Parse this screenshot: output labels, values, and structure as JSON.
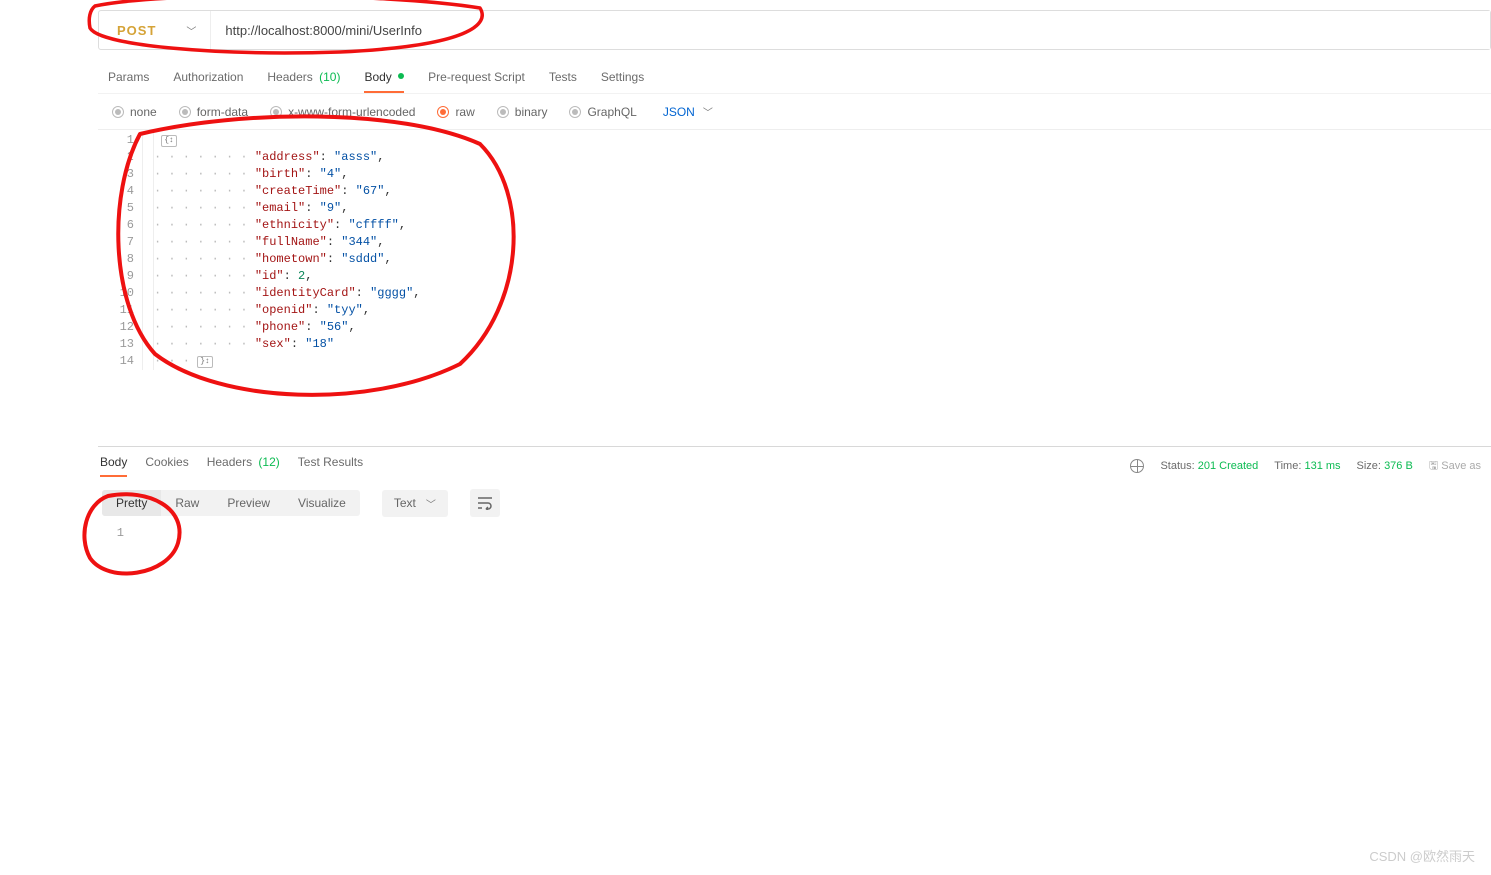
{
  "request": {
    "method": "POST",
    "url": "http://localhost:8000/mini/UserInfo",
    "tabs": {
      "params": "Params",
      "authorization": "Authorization",
      "headers": "Headers",
      "headers_count": "(10)",
      "body": "Body",
      "prerequest": "Pre-request Script",
      "tests": "Tests",
      "settings": "Settings"
    },
    "body_types": {
      "none": "none",
      "form_data": "form-data",
      "urlencoded": "x-www-form-urlencoded",
      "raw": "raw",
      "binary": "binary",
      "graphql": "GraphQL"
    },
    "lang": "JSON",
    "code": {
      "lines": [
        "1",
        "2",
        "3",
        "4",
        "5",
        "6",
        "7",
        "8",
        "9",
        "10",
        "11",
        "12",
        "13",
        "14"
      ],
      "pairs": [
        {
          "k": "\"address\"",
          "v": "\"asss\"",
          "t": "str",
          "comma": true
        },
        {
          "k": "\"birth\"",
          "v": "\"4\"",
          "t": "str",
          "comma": true
        },
        {
          "k": "\"createTime\"",
          "v": "\"67\"",
          "t": "str",
          "comma": true
        },
        {
          "k": "\"email\"",
          "v": "\"9\"",
          "t": "str",
          "comma": true
        },
        {
          "k": "\"ethnicity\"",
          "v": "\"cffff\"",
          "t": "str",
          "comma": true
        },
        {
          "k": "\"fullName\"",
          "v": "\"344\"",
          "t": "str",
          "comma": true
        },
        {
          "k": "\"hometown\"",
          "v": "\"sddd\"",
          "t": "str",
          "comma": true
        },
        {
          "k": "\"id\"",
          "v": "2",
          "t": "num",
          "comma": true
        },
        {
          "k": "\"identityCard\"",
          "v": "\"gggg\"",
          "t": "str",
          "comma": true
        },
        {
          "k": "\"openid\"",
          "v": "\"tyy\"",
          "t": "str",
          "comma": true
        },
        {
          "k": "\"phone\"",
          "v": "\"56\"",
          "t": "str",
          "comma": true
        },
        {
          "k": "\"sex\"",
          "v": "\"18\"",
          "t": "str",
          "comma": false
        }
      ]
    }
  },
  "response": {
    "tabs": {
      "body": "Body",
      "cookies": "Cookies",
      "headers": "Headers",
      "headers_count": "(12)",
      "test_results": "Test Results"
    },
    "meta": {
      "status_label": "Status:",
      "status_value": "201 Created",
      "time_label": "Time:",
      "time_value": "131 ms",
      "size_label": "Size:",
      "size_value": "376 B",
      "save_label": "Save as"
    },
    "view": {
      "pretty": "Pretty",
      "raw": "Raw",
      "preview": "Preview",
      "visualize": "Visualize",
      "format": "Text"
    },
    "body_line_no": "1"
  },
  "watermark": "CSDN @欧然雨天"
}
